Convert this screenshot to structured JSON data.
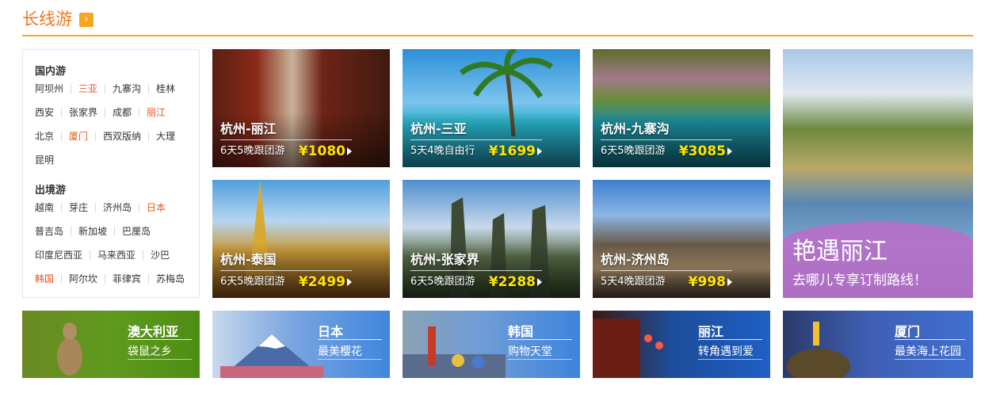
{
  "header": {
    "title": "长线游",
    "more_icon": "chevron-right-icon"
  },
  "panel": {
    "domestic": {
      "title": "国内游",
      "rows": [
        [
          {
            "label": "阿坝州",
            "hot": false
          },
          {
            "label": "三亚",
            "hot": true
          },
          {
            "label": "九寨沟",
            "hot": false
          },
          {
            "label": "桂林",
            "hot": false
          }
        ],
        [
          {
            "label": "西安",
            "hot": false
          },
          {
            "label": "张家界",
            "hot": false
          },
          {
            "label": "成都",
            "hot": false
          },
          {
            "label": "丽江",
            "hot": true
          }
        ],
        [
          {
            "label": "北京",
            "hot": false
          },
          {
            "label": "厦门",
            "hot": true
          },
          {
            "label": "西双版纳",
            "hot": false
          },
          {
            "label": "大理",
            "hot": false
          }
        ],
        [
          {
            "label": "昆明",
            "hot": false
          }
        ]
      ]
    },
    "outbound": {
      "title": "出境游",
      "rows": [
        [
          {
            "label": "越南",
            "hot": false
          },
          {
            "label": "芽庄",
            "hot": false
          },
          {
            "label": "济州岛",
            "hot": false
          },
          {
            "label": "日本",
            "hot": true
          }
        ],
        [
          {
            "label": "普吉岛",
            "hot": false
          },
          {
            "label": "新加坡",
            "hot": false
          },
          {
            "label": "巴厘岛",
            "hot": false
          }
        ],
        [
          {
            "label": "印度尼西亚",
            "hot": false
          },
          {
            "label": "马来西亚",
            "hot": false
          },
          {
            "label": "沙巴",
            "hot": false
          }
        ],
        [
          {
            "label": "韩国",
            "hot": true
          },
          {
            "label": "阿尔坎",
            "hot": false
          },
          {
            "label": "菲律宾",
            "hot": false
          },
          {
            "label": "苏梅岛",
            "hot": false
          }
        ]
      ]
    }
  },
  "tiles": [
    {
      "dest": "杭州-丽江",
      "trip": "6天5晚跟团游",
      "price": "¥1080"
    },
    {
      "dest": "杭州-三亚",
      "trip": "5天4晚自由行",
      "price": "¥1699"
    },
    {
      "dest": "杭州-九寨沟",
      "trip": "6天5晚跟团游",
      "price": "¥3085"
    },
    {
      "dest": "杭州-泰国",
      "trip": "6天5晚跟团游",
      "price": "¥2499"
    },
    {
      "dest": "杭州-张家界",
      "trip": "6天5晚跟团游",
      "price": "¥2288"
    },
    {
      "dest": "杭州-济州岛",
      "trip": "5天4晚跟团游",
      "price": "¥998"
    }
  ],
  "feature": {
    "title": "艳遇丽江",
    "subtitle": "去哪儿专享订制路线！"
  },
  "banners": [
    {
      "name": "澳大利亚",
      "tag": "袋鼠之乡"
    },
    {
      "name": "日本",
      "tag": "最美樱花"
    },
    {
      "name": "韩国",
      "tag": "购物天堂"
    },
    {
      "name": "丽江",
      "tag": "转角遇到爱"
    },
    {
      "name": "厦门",
      "tag": "最美海上花园"
    }
  ],
  "colors": {
    "accent": "#f0761e",
    "hot_link": "#e8541e",
    "price": "#ffe600",
    "feature_band": "#b670c8"
  }
}
